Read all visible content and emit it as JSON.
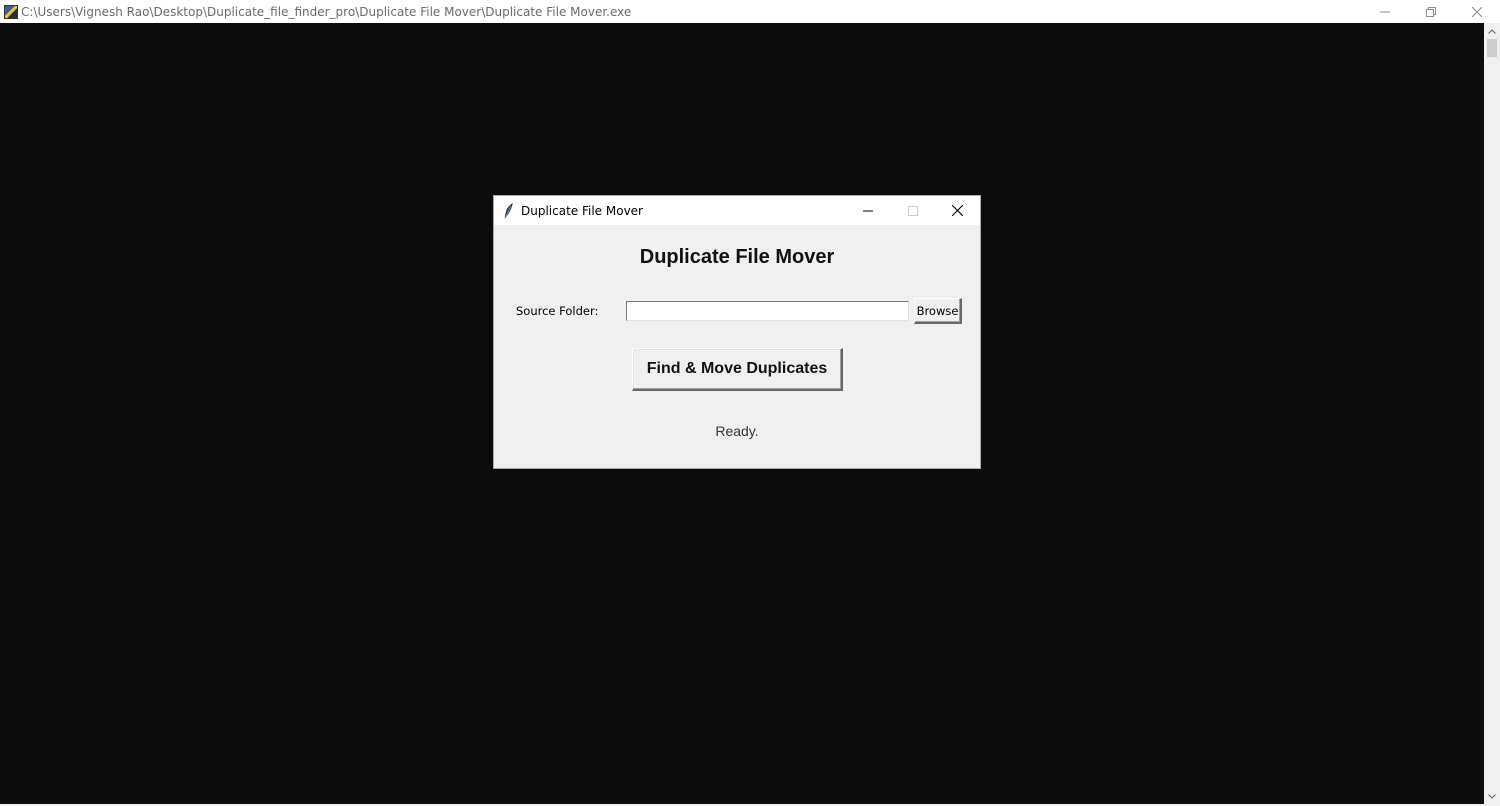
{
  "console_window": {
    "title": "C:\\Users\\Vignesh Rao\\Desktop\\Duplicate_file_finder_pro\\Duplicate File Mover\\Duplicate File Mover.exe",
    "controls": {
      "minimize": "—",
      "restore": "❐",
      "close": "✕"
    },
    "scroll_up": "⌃",
    "scroll_down": "⌄"
  },
  "dialog": {
    "title": "Duplicate File Mover",
    "heading": "Duplicate File Mover",
    "source_label": "Source Folder:",
    "source_value": "",
    "browse_label": "Browse",
    "action_label": "Find & Move Duplicates",
    "status": "Ready.",
    "controls": {
      "minimize": "minimize-icon",
      "maximize": "maximize-icon",
      "close": "close-icon"
    }
  }
}
